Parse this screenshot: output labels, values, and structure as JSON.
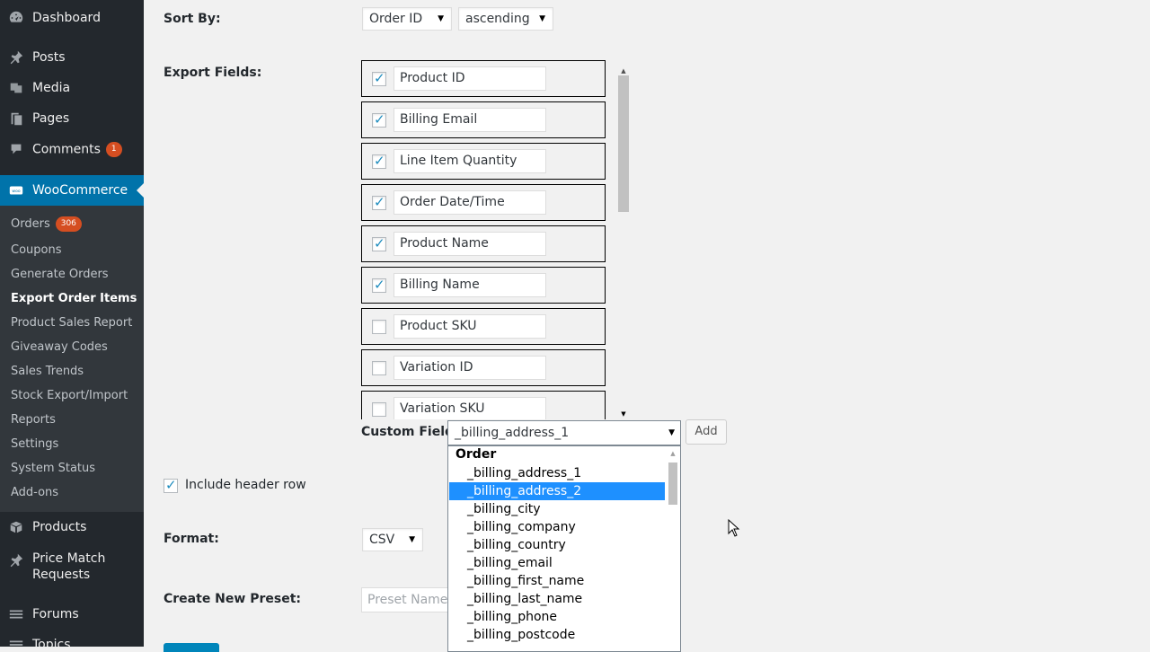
{
  "sidebar": {
    "top": [
      {
        "label": "Dashboard",
        "icon": "dashboard-icon"
      },
      {
        "label": "Posts",
        "icon": "pin-icon"
      },
      {
        "label": "Media",
        "icon": "media-icon"
      },
      {
        "label": "Pages",
        "icon": "pages-icon"
      },
      {
        "label": "Comments",
        "icon": "comment-icon",
        "badge": "1"
      },
      {
        "label": "WooCommerce",
        "icon": "woo-icon"
      }
    ],
    "sub": [
      {
        "label": "Orders",
        "badge": "306"
      },
      {
        "label": "Coupons"
      },
      {
        "label": "Generate Orders"
      },
      {
        "label": "Export Order Items"
      },
      {
        "label": "Product Sales Report"
      },
      {
        "label": "Giveaway Codes"
      },
      {
        "label": "Sales Trends"
      },
      {
        "label": "Stock Export/Import"
      },
      {
        "label": "Reports"
      },
      {
        "label": "Settings"
      },
      {
        "label": "System Status"
      },
      {
        "label": "Add-ons"
      }
    ],
    "bottom": [
      {
        "label": "Products",
        "icon": "products-icon"
      },
      {
        "label": "Price Match Requests",
        "line1": "Price Match",
        "line2": "Requests",
        "icon": "pin-icon"
      },
      {
        "label": "Forums",
        "icon": "forums-icon"
      },
      {
        "label": "Topics",
        "icon": "topics-icon"
      }
    ]
  },
  "sort": {
    "label": "Sort By:",
    "field_value": "Order ID",
    "direction_value": "ascending"
  },
  "export_fields": {
    "label": "Export Fields:",
    "items": [
      {
        "name": "Product ID",
        "checked": true
      },
      {
        "name": "Billing Email",
        "checked": true
      },
      {
        "name": "Line Item Quantity",
        "checked": true
      },
      {
        "name": "Order Date/Time",
        "checked": true
      },
      {
        "name": "Product Name",
        "checked": true
      },
      {
        "name": "Billing Name",
        "checked": true
      },
      {
        "name": "Product SKU",
        "checked": false
      },
      {
        "name": "Variation ID",
        "checked": false
      },
      {
        "name": "Variation SKU",
        "checked": false
      }
    ]
  },
  "custom_field": {
    "label": "Custom Field:",
    "value": "_billing_address_1",
    "add_label": "Add",
    "dropdown": {
      "group": "Order",
      "options": [
        "_billing_address_1",
        "_billing_address_2",
        "_billing_city",
        "_billing_company",
        "_billing_country",
        "_billing_email",
        "_billing_first_name",
        "_billing_last_name",
        "_billing_phone",
        "_billing_postcode"
      ],
      "highlighted": "_billing_address_2"
    }
  },
  "header_row": {
    "label": "Include header row",
    "checked": true
  },
  "format": {
    "label": "Format:",
    "value": "CSV"
  },
  "preset": {
    "label": "Create New Preset:",
    "placeholder": "Preset Name"
  },
  "colors": {
    "sidebar_bg": "#23282d",
    "submenu_bg": "#32373c",
    "accent": "#0073aa",
    "badge": "#d54e21",
    "highlight": "#1e90ff",
    "check": "#1e8cbe"
  }
}
